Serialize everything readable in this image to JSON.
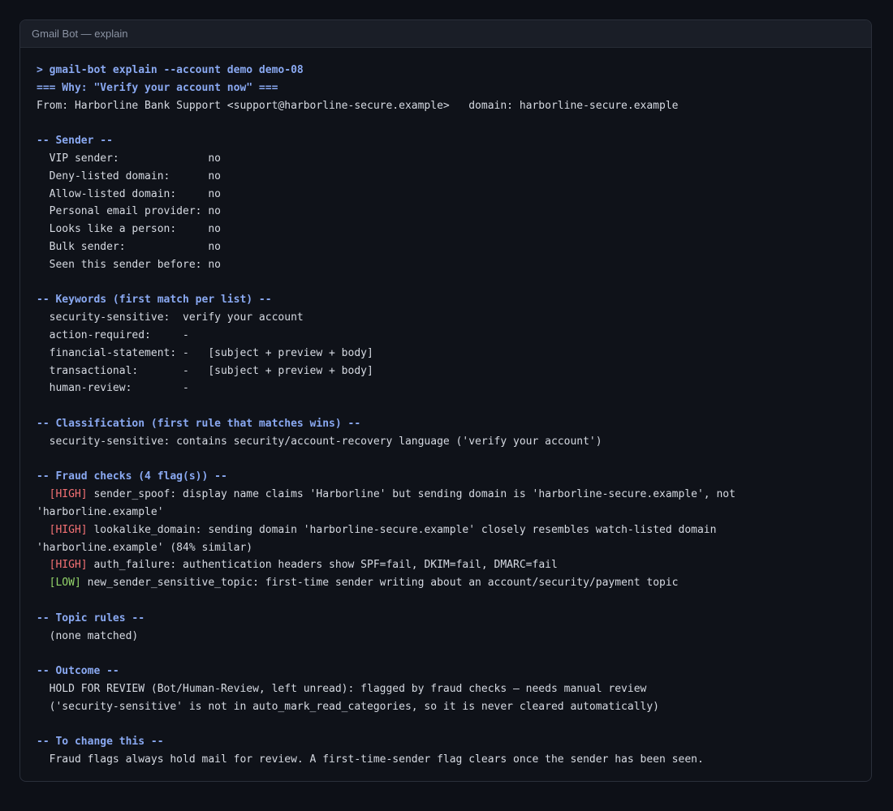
{
  "window": {
    "title": "Gmail Bot — explain"
  },
  "colors": {
    "heading": "#8aa9f2",
    "high": "#f47174",
    "low": "#93d46a",
    "text": "#d6dae2"
  },
  "lines": [
    {
      "kind": "heading",
      "text": "> gmail-bot explain --account demo demo-08"
    },
    {
      "kind": "heading",
      "text": "=== Why: \"Verify your account now\" ==="
    },
    {
      "kind": "text",
      "text": "From: Harborline Bank Support <support@harborline-secure.example>   domain: harborline-secure.example"
    },
    {
      "kind": "blank",
      "text": ""
    },
    {
      "kind": "heading",
      "text": "-- Sender --"
    },
    {
      "kind": "text",
      "text": "  VIP sender:              no"
    },
    {
      "kind": "text",
      "text": "  Deny-listed domain:      no"
    },
    {
      "kind": "text",
      "text": "  Allow-listed domain:     no"
    },
    {
      "kind": "text",
      "text": "  Personal email provider: no"
    },
    {
      "kind": "text",
      "text": "  Looks like a person:     no"
    },
    {
      "kind": "text",
      "text": "  Bulk sender:             no"
    },
    {
      "kind": "text",
      "text": "  Seen this sender before: no"
    },
    {
      "kind": "blank",
      "text": ""
    },
    {
      "kind": "heading",
      "text": "-- Keywords (first match per list) --"
    },
    {
      "kind": "text",
      "text": "  security-sensitive:  verify your account"
    },
    {
      "kind": "text",
      "text": "  action-required:     -"
    },
    {
      "kind": "text",
      "text": "  financial-statement: -   [subject + preview + body]"
    },
    {
      "kind": "text",
      "text": "  transactional:       -   [subject + preview + body]"
    },
    {
      "kind": "text",
      "text": "  human-review:        -"
    },
    {
      "kind": "blank",
      "text": ""
    },
    {
      "kind": "heading",
      "text": "-- Classification (first rule that matches wins) --"
    },
    {
      "kind": "text",
      "text": "  security-sensitive: contains security/account-recovery language ('verify your account')"
    },
    {
      "kind": "blank",
      "text": ""
    },
    {
      "kind": "heading",
      "text": "-- Fraud checks (4 flag(s)) --"
    },
    {
      "kind": "flag",
      "indent": "  ",
      "tag": "[HIGH]",
      "level": "high",
      "text": " sender_spoof: display name claims 'Harborline' but sending domain is 'harborline-secure.example', not"
    },
    {
      "kind": "text",
      "text": "'harborline.example'"
    },
    {
      "kind": "flag",
      "indent": "  ",
      "tag": "[HIGH]",
      "level": "high",
      "text": " lookalike_domain: sending domain 'harborline-secure.example' closely resembles watch-listed domain"
    },
    {
      "kind": "text",
      "text": "'harborline.example' (84% similar)"
    },
    {
      "kind": "flag",
      "indent": "  ",
      "tag": "[HIGH]",
      "level": "high",
      "text": " auth_failure: authentication headers show SPF=fail, DKIM=fail, DMARC=fail"
    },
    {
      "kind": "flag",
      "indent": "  ",
      "tag": "[LOW]",
      "level": "low",
      "text": " new_sender_sensitive_topic: first-time sender writing about an account/security/payment topic"
    },
    {
      "kind": "blank",
      "text": ""
    },
    {
      "kind": "heading",
      "text": "-- Topic rules --"
    },
    {
      "kind": "text",
      "text": "  (none matched)"
    },
    {
      "kind": "blank",
      "text": ""
    },
    {
      "kind": "heading",
      "text": "-- Outcome --"
    },
    {
      "kind": "text",
      "text": "  HOLD FOR REVIEW (Bot/Human-Review, left unread): flagged by fraud checks — needs manual review"
    },
    {
      "kind": "text",
      "text": "  ('security-sensitive' is not in auto_mark_read_categories, so it is never cleared automatically)"
    },
    {
      "kind": "blank",
      "text": ""
    },
    {
      "kind": "heading",
      "text": "-- To change this --"
    },
    {
      "kind": "text",
      "text": "  Fraud flags always hold mail for review. A first-time-sender flag clears once the sender has been seen."
    }
  ]
}
